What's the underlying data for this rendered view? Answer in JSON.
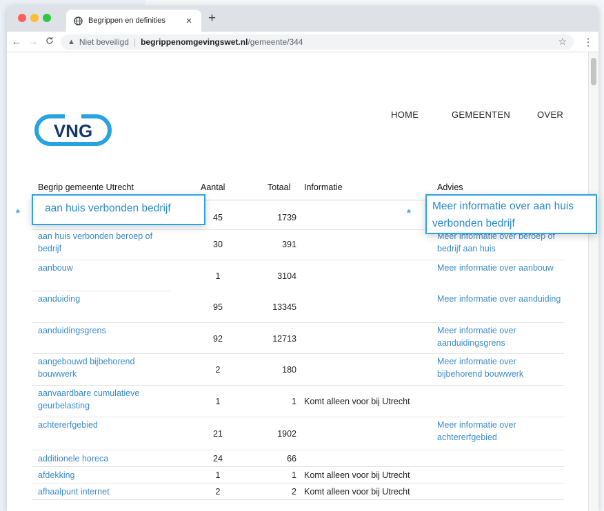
{
  "browser": {
    "tab_title": "Begrippen en definities",
    "close_glyph": "×",
    "new_tab_glyph": "+",
    "security_label": "Niet beveiligd",
    "url_domain": "begrippenomgevingswet.nl",
    "url_path": "/gemeente/344"
  },
  "site": {
    "logo_text": "VNG",
    "nav": [
      "HOME",
      "GEMEENTEN",
      "OVER"
    ]
  },
  "table": {
    "headers": [
      "Begrip gemeente Utrecht",
      "Aantal",
      "Totaal",
      "Informatie",
      "Advies"
    ],
    "rows": [
      {
        "term": "aan huis verbonden bedrijf",
        "aantal": "45",
        "totaal": "1739",
        "info": "",
        "advies": "Meer informatie over aan huis verbonden bedrijf"
      },
      {
        "term": "aan huis verbonden beroep of bedrijf",
        "aantal": "30",
        "totaal": "391",
        "info": "",
        "advies": "Meer informatie over beroep of bedrijf aan huis"
      },
      {
        "term": "aanbouw",
        "aantal": "1",
        "totaal": "3104",
        "info": "",
        "advies": "Meer informatie over aanbouw"
      },
      {
        "term": "aanduiding",
        "aantal": "95",
        "totaal": "13345",
        "info": "",
        "advies": "Meer informatie over aanduiding"
      },
      {
        "term": "aanduidingsgrens",
        "aantal": "92",
        "totaal": "12713",
        "info": "",
        "advies": "Meer informatie over aanduidingsgrens"
      },
      {
        "term": "aangebouwd bijbehorend bouwwerk",
        "aantal": "2",
        "totaal": "180",
        "info": "",
        "advies": "Meer informatie over bijbehorend bouwwerk"
      },
      {
        "term": "aanvaardbare cumulatieve geurbelasting",
        "aantal": "1",
        "totaal": "1",
        "info": "Komt alleen voor bij Utrecht",
        "advies": ""
      },
      {
        "term": "achtererfgebied",
        "aantal": "21",
        "totaal": "1902",
        "info": "",
        "advies": "Meer informatie over achtererfgebied"
      },
      {
        "term": "additionele horeca",
        "aantal": "24",
        "totaal": "66",
        "info": "",
        "advies": ""
      },
      {
        "term": "afdekking",
        "aantal": "1",
        "totaal": "1",
        "info": "Komt alleen voor bij Utrecht",
        "advies": ""
      },
      {
        "term": "afhaalpunt internet",
        "aantal": "2",
        "totaal": "2",
        "info": "Komt alleen voor bij Utrecht",
        "advies": ""
      }
    ]
  },
  "callouts": {
    "marker": "*",
    "left_text": "aan huis verbonden bedrijf",
    "right_text": "Meer informatie over aan huis verbonden bedrijf"
  }
}
